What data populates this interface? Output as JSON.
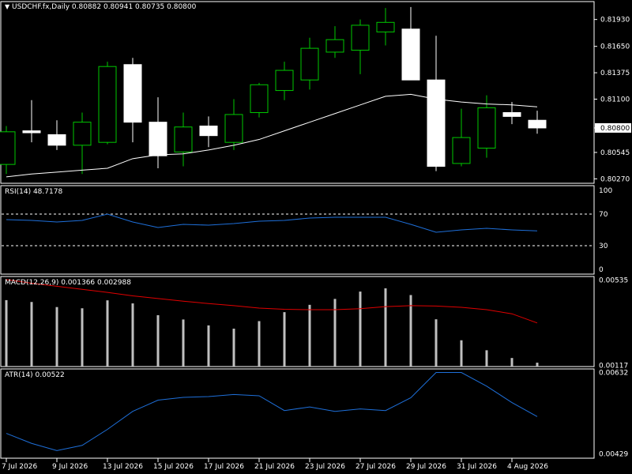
{
  "header": {
    "symbol_line": "USDCHF.fx,Daily  0.80882 0.80941 0.80735 0.80800",
    "rsi_label": "RSI(14) 48.7178",
    "macd_label": "MACD(12,26,9) 0.001366 0.002988",
    "atr_label": "ATR(14) 0.00522"
  },
  "colors": {
    "background": "#000000",
    "grid": "#ffffff",
    "bull_candle": "#00c800",
    "bear_candle": "#ffffff",
    "ma_line": "#ffffff",
    "rsi_line": "#1e6fd9",
    "macd_signal": "#e00000",
    "macd_hist": "#c0c0c0",
    "atr_line": "#1e6fd9",
    "price_badge_bg": "#ffffff",
    "price_badge_text": "#000000"
  },
  "chart_data": [
    {
      "type": "candlestick",
      "name": "USDCHF.fx,Daily",
      "dates": [
        "7 Jul 2026",
        "8 Jul 2026",
        "9 Jul 2026",
        "10 Jul 2026",
        "13 Jul 2026",
        "14 Jul 2026",
        "15 Jul 2026",
        "16 Jul 2026",
        "17 Jul 2026",
        "20 Jul 2026",
        "21 Jul 2026",
        "22 Jul 2026",
        "23 Jul 2026",
        "24 Jul 2026",
        "27 Jul 2026",
        "28 Jul 2026",
        "29 Jul 2026",
        "30 Jul 2026",
        "31 Jul 2026",
        "3 Aug 2026",
        "4 Aug 2026",
        "5 Aug 2026"
      ],
      "open": [
        0.8042,
        0.8077,
        0.8073,
        0.8062,
        0.8065,
        0.8146,
        0.8086,
        0.8055,
        0.8082,
        0.8065,
        0.8096,
        0.8119,
        0.813,
        0.8159,
        0.8161,
        0.818,
        0.8183,
        0.813,
        0.8043,
        0.8059,
        0.8096,
        0.8088
      ],
      "high": [
        0.8082,
        0.8109,
        0.8088,
        0.8096,
        0.8149,
        0.8153,
        0.8112,
        0.8096,
        0.8092,
        0.811,
        0.8127,
        0.8149,
        0.8174,
        0.8186,
        0.8193,
        0.8205,
        0.8206,
        0.8176,
        0.81,
        0.8114,
        0.8107,
        0.8098
      ],
      "low": [
        0.8032,
        0.8065,
        0.8057,
        0.8032,
        0.8063,
        0.8065,
        0.8038,
        0.804,
        0.806,
        0.8057,
        0.8091,
        0.8109,
        0.812,
        0.8153,
        0.8136,
        0.8166,
        0.8183,
        0.8035,
        0.804,
        0.8049,
        0.8084,
        0.8074
      ],
      "close": [
        0.8076,
        0.8075,
        0.8062,
        0.8086,
        0.8144,
        0.8086,
        0.8051,
        0.8081,
        0.8072,
        0.8094,
        0.8125,
        0.814,
        0.8163,
        0.8172,
        0.8187,
        0.819,
        0.813,
        0.804,
        0.807,
        0.8101,
        0.8092,
        0.808
      ],
      "ma": [
        0.8029,
        0.8032,
        0.8034,
        0.8036,
        0.8038,
        0.8048,
        0.8052,
        0.8053,
        0.8057,
        0.8062,
        0.8068,
        0.8077,
        0.8086,
        0.8095,
        0.8104,
        0.8113,
        0.8115,
        0.811,
        0.8107,
        0.8105,
        0.8104,
        0.8102
      ],
      "ylim": [
        0.8024,
        0.821
      ],
      "y_ticks": [
        "0.81930",
        "0.81650",
        "0.81375",
        "0.81100",
        "0.80800",
        "0.80545",
        "0.80270"
      ],
      "y_tick_values": [
        0.8193,
        0.8165,
        0.81375,
        0.811,
        0.808,
        0.80545,
        0.8027
      ],
      "last_price": "0.80800",
      "last_price_value": 0.808
    },
    {
      "type": "line",
      "name": "RSI(14) 48.7178",
      "values": [
        63,
        62,
        60,
        62,
        70,
        60,
        53,
        57,
        56,
        58,
        61,
        62,
        65,
        66,
        66,
        66,
        57,
        47,
        50,
        52,
        50,
        48.7
      ],
      "ylim": [
        0,
        100
      ],
      "y_ticks": [
        "100",
        "70",
        "30",
        "0"
      ],
      "y_tick_values": [
        100,
        70,
        30,
        0
      ],
      "levels": [
        70,
        30
      ]
    },
    {
      "type": "bar+line",
      "name": "MACD(12,26,9) 0.001366 0.002988",
      "hist": [
        0.00437,
        0.00428,
        0.00403,
        0.00397,
        0.00436,
        0.00421,
        0.00363,
        0.00342,
        0.00313,
        0.00297,
        0.00334,
        0.00378,
        0.00414,
        0.00443,
        0.00479,
        0.00495,
        0.00462,
        0.00343,
        0.0024,
        0.00191,
        0.00153,
        0.0013
      ],
      "signal": [
        0.00538,
        0.0052,
        0.00505,
        0.0049,
        0.00475,
        0.00458,
        0.00445,
        0.00432,
        0.0042,
        0.0041,
        0.00398,
        0.00392,
        0.0039,
        0.0039,
        0.00395,
        0.00405,
        0.0041,
        0.00408,
        0.00402,
        0.0039,
        0.0037,
        0.00325
      ],
      "ylim": [
        0.00111,
        0.00553
      ],
      "y_ticks": [
        "0.00535",
        "0.00117"
      ],
      "y_tick_values": [
        0.00535,
        0.00117
      ]
    },
    {
      "type": "line",
      "name": "ATR(14) 0.00522",
      "values": [
        0.0048,
        0.00455,
        0.00437,
        0.0045,
        0.0049,
        0.00535,
        0.00563,
        0.0057,
        0.00572,
        0.00577,
        0.00574,
        0.00537,
        0.00546,
        0.00535,
        0.00541,
        0.00537,
        0.00569,
        0.00632,
        0.00632,
        0.00598,
        0.00557,
        0.00522
      ],
      "ylim": [
        0.00418,
        0.00641
      ],
      "y_ticks": [
        "0.00632",
        "0.00429"
      ],
      "y_tick_values": [
        0.00632,
        0.00429
      ]
    }
  ],
  "x_axis": {
    "labels": [
      "7 Jul 2026",
      "9 Jul 2026",
      "13 Jul 2026",
      "15 Jul 2026",
      "17 Jul 2026",
      "21 Jul 2026",
      "23 Jul 2026",
      "27 Jul 2026",
      "29 Jul 2026",
      "31 Jul 2026",
      "4 Aug 2026"
    ]
  }
}
